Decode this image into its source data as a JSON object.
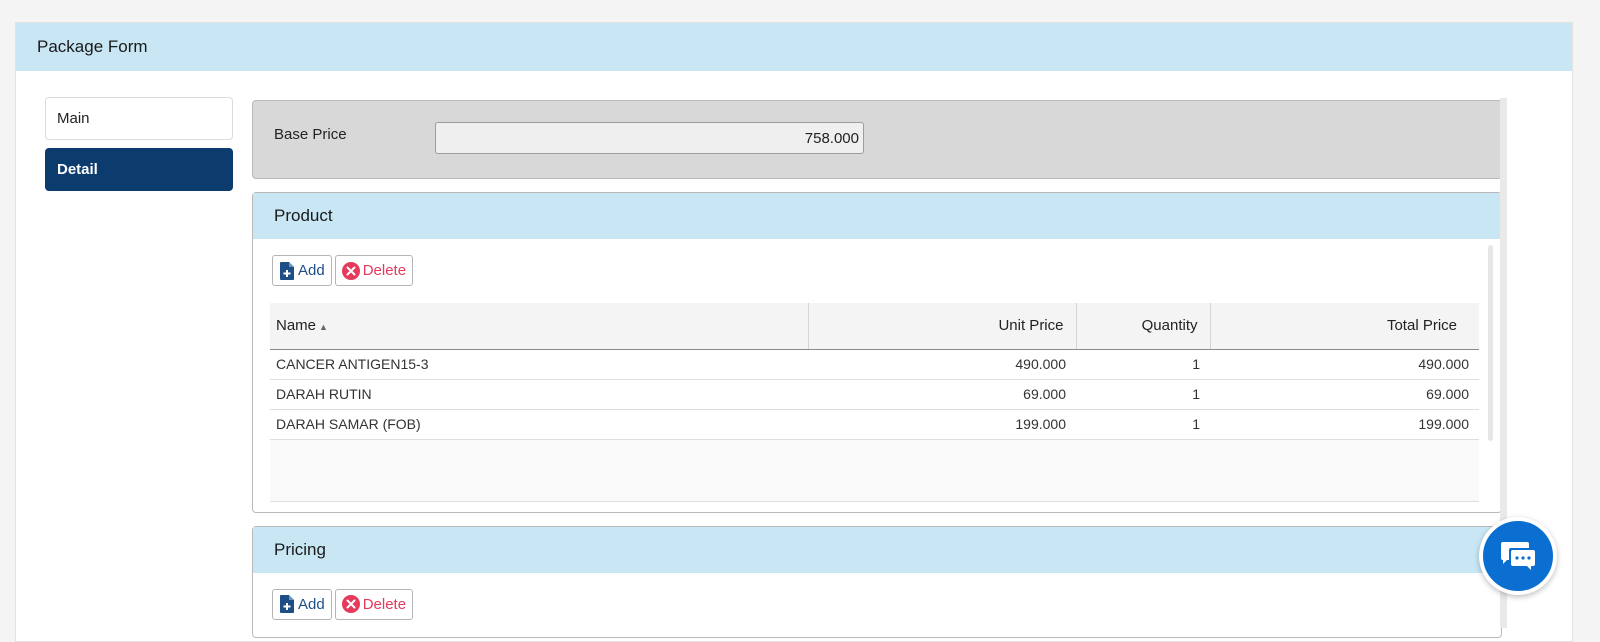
{
  "window": {
    "title": "Package Form"
  },
  "sidebar": {
    "items": [
      {
        "label": "Main",
        "active": false
      },
      {
        "label": "Detail",
        "active": true
      }
    ]
  },
  "base_price": {
    "label": "Base Price",
    "value": "758.000"
  },
  "product": {
    "title": "Product",
    "add_label": "Add",
    "delete_label": "Delete",
    "columns": {
      "name": "Name",
      "unit_price": "Unit Price",
      "quantity": "Quantity",
      "total_price": "Total Price"
    },
    "rows": [
      {
        "name": "CANCER ANTIGEN15-3",
        "unit_price": "490.000",
        "quantity": "1",
        "total_price": "490.000"
      },
      {
        "name": "DARAH RUTIN",
        "unit_price": "69.000",
        "quantity": "1",
        "total_price": "69.000"
      },
      {
        "name": "DARAH SAMAR (FOB)",
        "unit_price": "199.000",
        "quantity": "1",
        "total_price": "199.000"
      }
    ]
  },
  "pricing": {
    "title": "Pricing",
    "add_label": "Add",
    "delete_label": "Delete"
  },
  "colors": {
    "header_bg": "#c8e6f4",
    "active_nav": "#0c3b6e",
    "add": "#1d4f86",
    "delete": "#e53a5c",
    "chat": "#0b6fd1"
  }
}
